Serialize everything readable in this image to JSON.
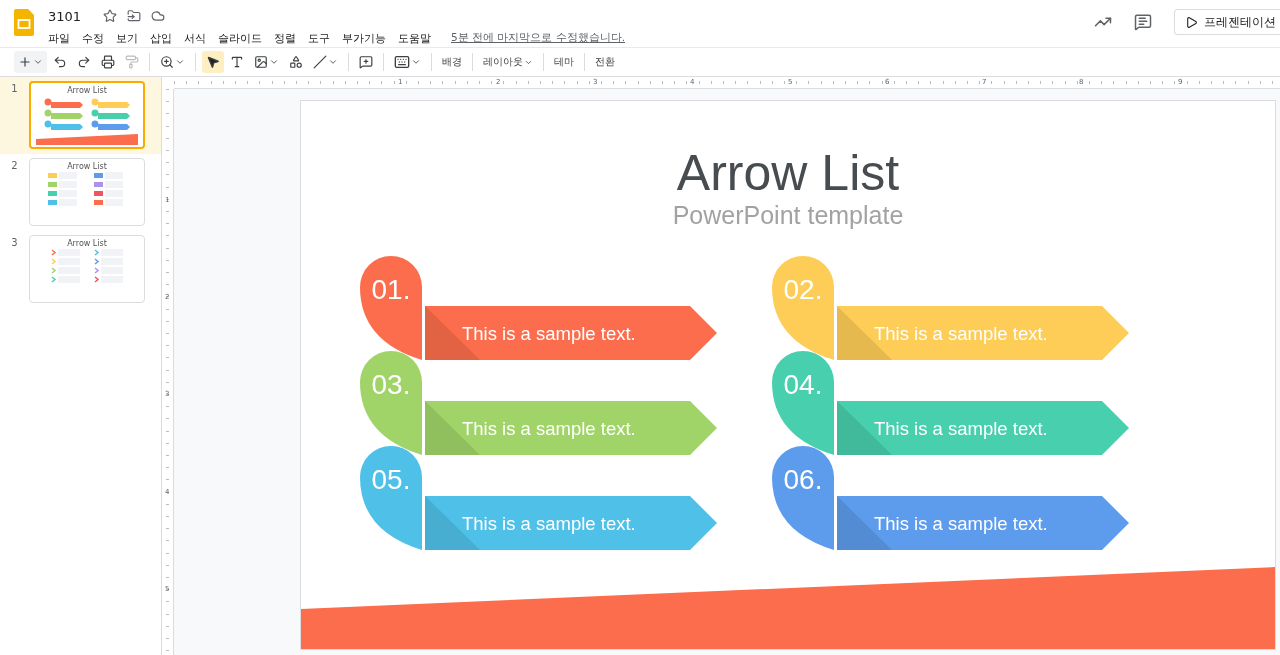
{
  "document": {
    "title": "3101",
    "last_edit": "5분 전에 마지막으로 수정했습니다."
  },
  "menu": [
    "파일",
    "수정",
    "보기",
    "삽입",
    "서식",
    "슬라이드",
    "정렬",
    "도구",
    "부가기능",
    "도움말"
  ],
  "present_button": "프레젠테이션",
  "toolbar": {
    "text_buttons": [
      {
        "label": "배경",
        "dropdown": false
      },
      {
        "label": "레이아웃",
        "dropdown": true
      },
      {
        "label": "테마",
        "dropdown": false
      },
      {
        "label": "전환",
        "dropdown": false
      }
    ]
  },
  "filmstrip": [
    {
      "number": "1",
      "title": "Arrow List",
      "selected": true,
      "kind": "arrows"
    },
    {
      "number": "2",
      "title": "Arrow List",
      "selected": false,
      "kind": "tags"
    },
    {
      "number": "3",
      "title": "Arrow List",
      "selected": false,
      "kind": "chevrons"
    }
  ],
  "ruler": {
    "horizontal": [
      "1",
      "2",
      "3",
      "4",
      "5",
      "6",
      "7",
      "8",
      "9"
    ],
    "vertical": [
      "1",
      "2",
      "3",
      "4",
      "5"
    ]
  },
  "slide": {
    "title": "Arrow List",
    "subtitle": "PowerPoint template",
    "items": [
      {
        "number": "01.",
        "text": "This is a sample text.",
        "color": "#fb6d4c"
      },
      {
        "number": "02.",
        "text": "This is a sample text.",
        "color": "#fecd57"
      },
      {
        "number": "03.",
        "text": "This is a sample text.",
        "color": "#a0d468"
      },
      {
        "number": "04.",
        "text": "This is a sample text.",
        "color": "#48cfad"
      },
      {
        "number": "05.",
        "text": "This is a sample text.",
        "color": "#4fc0e8"
      },
      {
        "number": "06.",
        "text": "This is a sample text.",
        "color": "#5d9cec"
      }
    ]
  }
}
